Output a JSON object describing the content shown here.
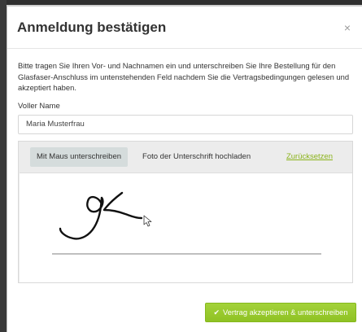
{
  "modal": {
    "title": "Anmeldung bestätigen",
    "close_icon": "×",
    "intro": "Bitte tragen Sie Ihren Vor- und Nachnamen ein und unterschreiben Sie Ihre Bestellung für den Glasfaser-Anschluss im untenstehenden Feld nachdem Sie die Vertragsbedingungen gelesen und akzeptiert haben.",
    "name_label": "Voller Name",
    "name_value": "Maria Musterfrau"
  },
  "signature": {
    "tabs": [
      {
        "label": "Mit Maus unterschreiben",
        "active": true
      },
      {
        "label": "Foto der Unterschrift hochladen",
        "active": false
      }
    ],
    "reset_label": "Zurücksetzen",
    "cursor_icon": "mouse-pointer-icon"
  },
  "footer": {
    "submit_label": "Vertrag akzeptieren & unterschreiben",
    "submit_icon": "check-icon"
  },
  "colors": {
    "accent_green": "#9acd32",
    "link_green": "#8bb31b",
    "panel_gray": "#ececec",
    "active_tab": "#d5dcdc"
  }
}
